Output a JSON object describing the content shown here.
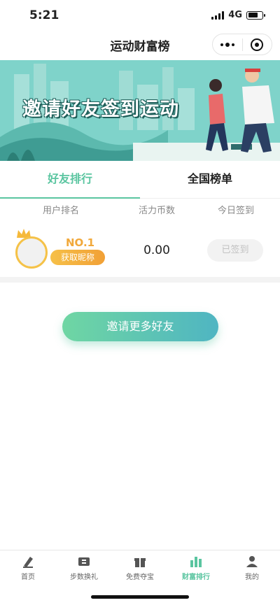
{
  "status": {
    "time": "5:21",
    "network": "4G"
  },
  "nav": {
    "title": "运动财富榜"
  },
  "banner": {
    "text": "邀请好友签到运动"
  },
  "tabs": [
    {
      "label": "好友排行",
      "active": true
    },
    {
      "label": "全国榜单",
      "active": false
    }
  ],
  "table": {
    "headers": [
      "用户排名",
      "活力币数",
      "今日签到"
    ],
    "rows": [
      {
        "rank": "NO.1",
        "nickname_button": "获取昵称",
        "coins": "0.00",
        "checkin": "已签到"
      }
    ]
  },
  "invite_button": "邀请更多好友",
  "tabbar": [
    {
      "label": "首页",
      "icon": "home-icon",
      "active": false
    },
    {
      "label": "步数换礼",
      "icon": "ticket-icon",
      "active": false
    },
    {
      "label": "免费夺宝",
      "icon": "gift-icon",
      "active": false
    },
    {
      "label": "财富排行",
      "icon": "bar-chart-icon",
      "active": true
    },
    {
      "label": "我的",
      "icon": "user-icon",
      "active": false
    }
  ],
  "colors": {
    "accent": "#5ac5a0",
    "gold": "#f1a83a",
    "banner_bg": "#74cfc6"
  }
}
